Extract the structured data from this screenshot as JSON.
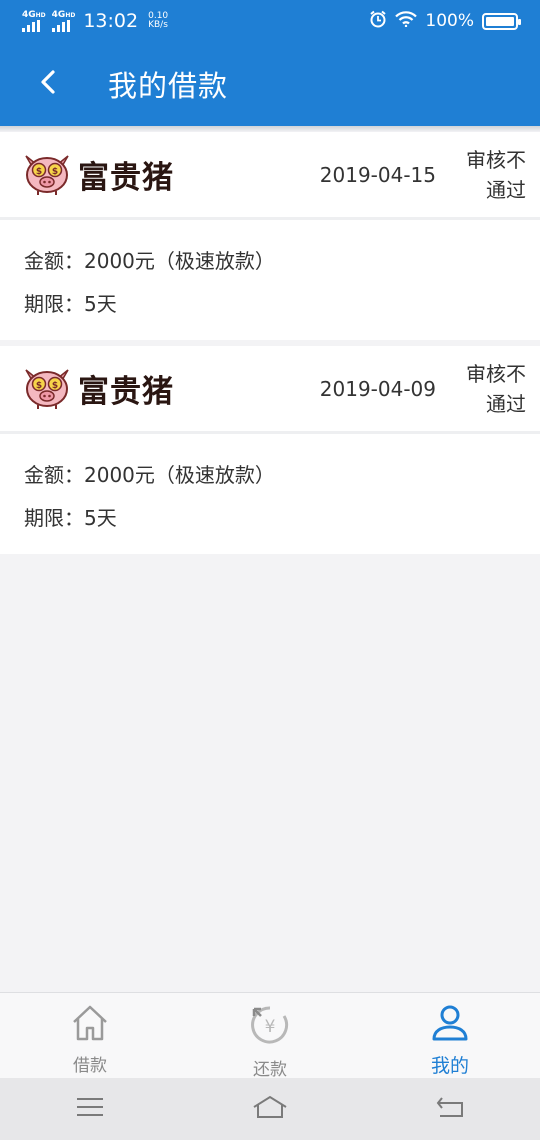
{
  "status_bar": {
    "network_1": "4G",
    "network_1_sup": "HD",
    "network_2": "4G",
    "network_2_sup": "HD",
    "time": "13:02",
    "speed_value": "0.10",
    "speed_unit": "KB/s",
    "battery": "100%",
    "battery_level": 1.0
  },
  "header": {
    "title": "我的借款",
    "back_icon": "chevron-left-icon"
  },
  "loans": [
    {
      "brand": "富贵猪",
      "date": "2019-04-15",
      "status_line1": "审核不",
      "status_line2": "通过",
      "amount": "金额：2000元（极速放款）",
      "term": "期限：5天"
    },
    {
      "brand": "富贵猪",
      "date": "2019-04-09",
      "status_line1": "审核不",
      "status_line2": "通过",
      "amount": "金额：2000元（极速放款）",
      "term": "期限：5天"
    }
  ],
  "tabs": [
    {
      "label": "借款",
      "icon": "home-icon",
      "active": false
    },
    {
      "label": "还款",
      "icon": "repay-yen-icon",
      "active": false
    },
    {
      "label": "我的",
      "icon": "user-icon",
      "active": true
    }
  ],
  "system_nav": [
    "menu-icon",
    "home-icon",
    "back-icon"
  ],
  "colors": {
    "primary": "#1f7fd4",
    "background": "#f3f3f5",
    "inactive": "#8a8a8a"
  }
}
